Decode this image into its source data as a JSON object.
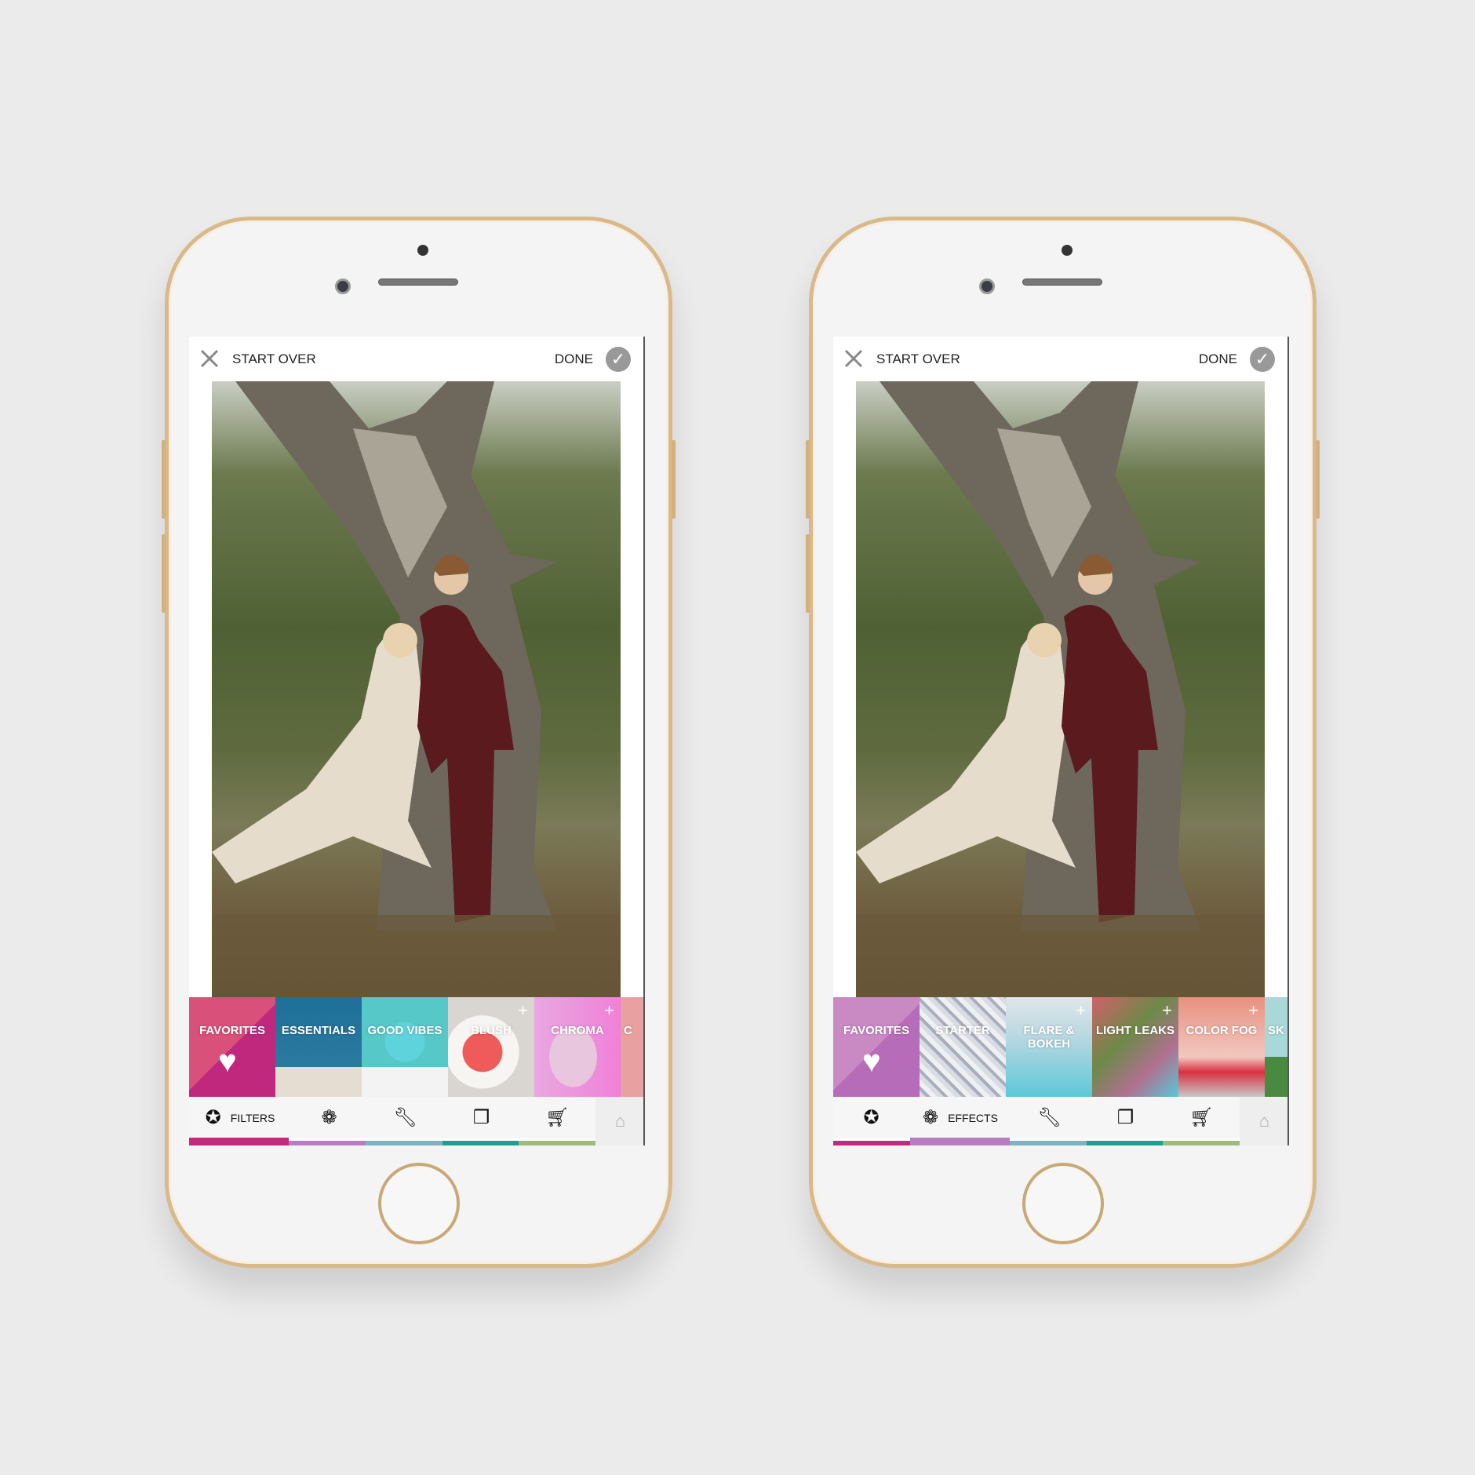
{
  "colors": {
    "gold": "#d9b98a",
    "bars": [
      "#c42a7c",
      "#b77dc0",
      "#7fb3c0",
      "#1fa08e",
      "#9dbb7e"
    ]
  },
  "phones": [
    {
      "start_over": "START OVER",
      "done": "DONE",
      "tiles": [
        {
          "label": "FAVORITES",
          "icon": "heart-icon"
        },
        {
          "label": "ESSENTIALS"
        },
        {
          "label": "GOOD VIBES"
        },
        {
          "label": "BLUSH",
          "plus": "+"
        },
        {
          "label": "CHROMA",
          "plus": "+"
        },
        {
          "label": "C"
        }
      ],
      "nav": {
        "active": "filters",
        "active_label": "FILTERS",
        "items": [
          "filters-icon",
          "effects-icon",
          "tools-icon",
          "layers-icon",
          "cart-icon"
        ],
        "home": "home-icon"
      }
    },
    {
      "start_over": "START OVER",
      "done": "DONE",
      "tiles": [
        {
          "label": "FAVORITES",
          "icon": "heart-icon"
        },
        {
          "label": "STARTER"
        },
        {
          "label": "FLARE & BOKEH",
          "plus": "+"
        },
        {
          "label": "LIGHT LEAKS",
          "plus": "+"
        },
        {
          "label": "COLOR FOG",
          "plus": "+"
        },
        {
          "label": "SK"
        }
      ],
      "nav": {
        "active": "effects",
        "active_label": "EFFECTS",
        "items": [
          "filters-icon",
          "effects-icon",
          "tools-icon",
          "layers-icon",
          "cart-icon"
        ],
        "home": "home-icon"
      }
    }
  ]
}
